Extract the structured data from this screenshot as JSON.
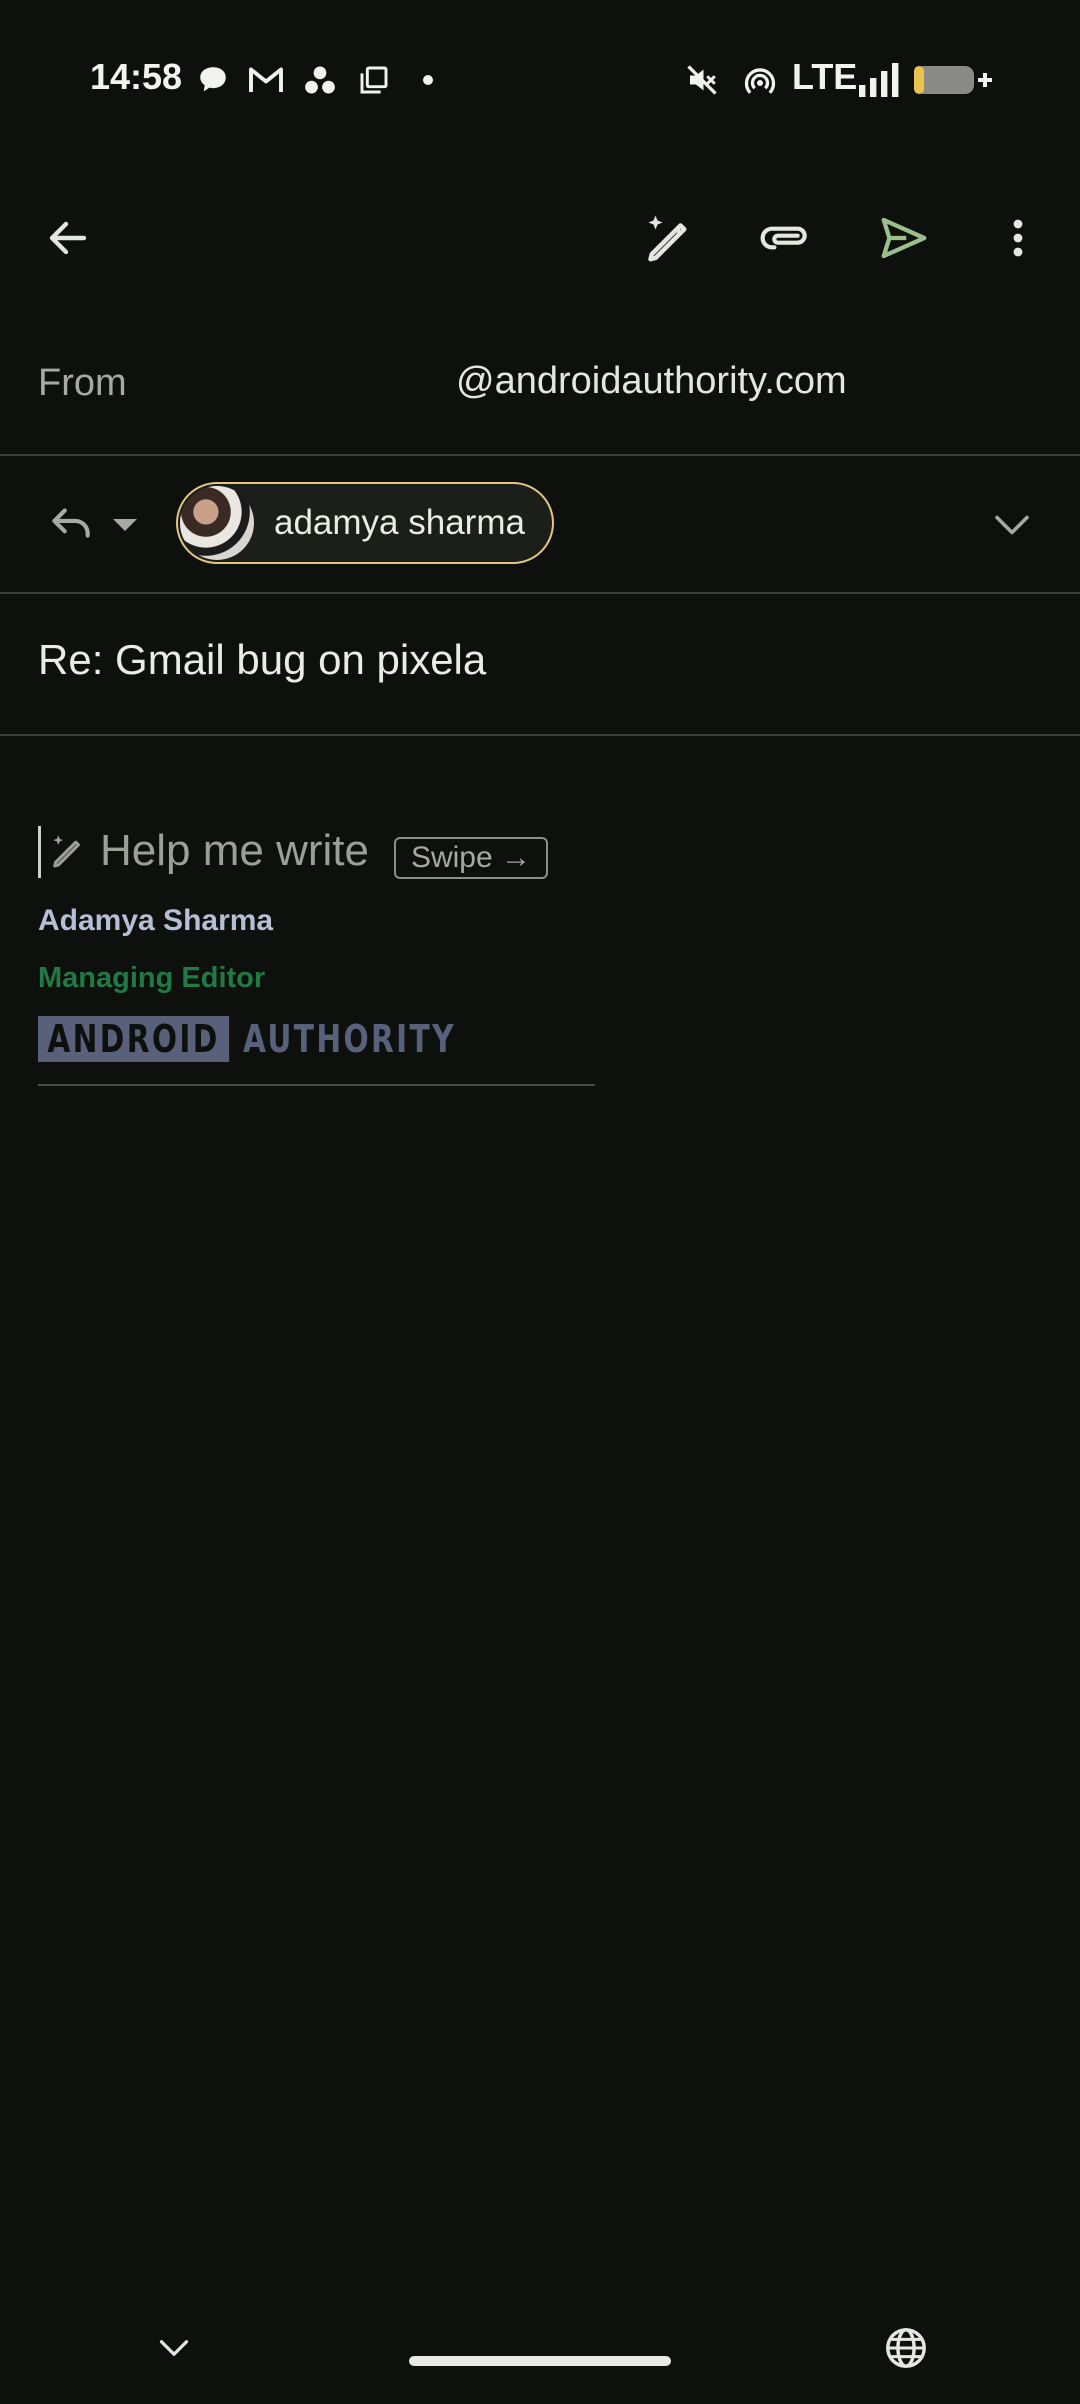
{
  "status_bar": {
    "time": "14:58",
    "network": "LTE",
    "icons": [
      "chat-bubble-icon",
      "gmail-icon",
      "dots-cluster-icon",
      "copy-icon",
      "dot-icon",
      "mute-icon",
      "hotspot-icon",
      "signal-icon",
      "battery-charging-icon"
    ]
  },
  "toolbar": {
    "back": "back-arrow-icon",
    "actions": [
      "help-me-write-icon",
      "attach-icon",
      "send-icon",
      "more-vert-icon"
    ],
    "colors": {
      "send": "#9cc08a",
      "icons": "#e6e6e1"
    }
  },
  "from": {
    "label": "From",
    "address": "@androidauthority.com"
  },
  "to": {
    "reply_mode": "reply-icon",
    "recipient_name": "adamya sharma",
    "chip_border": "#e4c583"
  },
  "subject": {
    "text": "Re: Gmail bug on pixela"
  },
  "body": {
    "help_me_write": "Help me write",
    "swipe_hint": "Swipe →"
  },
  "signature": {
    "name": "Adamya Sharma",
    "title": "Managing Editor",
    "logo_left": "ANDROID",
    "logo_right": "AUTHORITY",
    "colors": {
      "name": "#b7bfd6",
      "title": "#1f7a44",
      "logo": "#59607a"
    }
  },
  "bottom": {
    "left": "chevron-down-icon",
    "right": "globe-icon"
  }
}
